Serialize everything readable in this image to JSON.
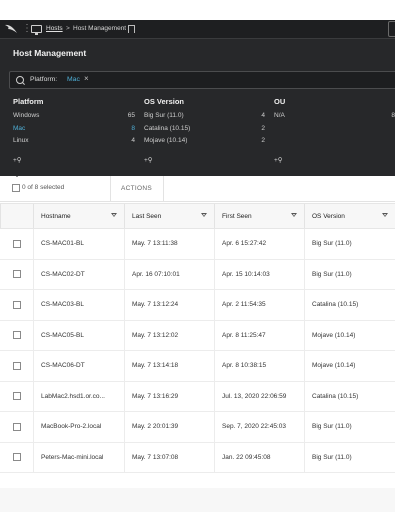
{
  "breadcrumb": {
    "hosts": "Hosts",
    "separator": ">",
    "current": "Host Management"
  },
  "page_title": "Host Management",
  "filter": {
    "key": "Platform:",
    "value": "Mac",
    "remove": "×"
  },
  "facets": {
    "platform": {
      "title": "Platform",
      "items": [
        {
          "label": "Windows",
          "count": "65"
        },
        {
          "label": "Mac",
          "count": "8"
        },
        {
          "label": "Linux",
          "count": "4"
        }
      ],
      "add": "+⚲"
    },
    "os_version": {
      "title": "OS Version",
      "items": [
        {
          "label": "Big Sur (11.0)",
          "count": "4"
        },
        {
          "label": "Catalina (10.15)",
          "count": "2"
        },
        {
          "label": "Mojave (10.14)",
          "count": "2"
        }
      ],
      "add": "+⚲"
    },
    "ou": {
      "title": "OU",
      "items": [
        {
          "label": "N/A",
          "count": "8"
        }
      ],
      "add": "+⚲"
    }
  },
  "toolbar": {
    "selection": "0 of 8 selected",
    "actions": "ACTIONS"
  },
  "table": {
    "headers": [
      "Hostname",
      "Last Seen",
      "First Seen",
      "OS Version"
    ],
    "rows": [
      [
        "CS-MAC01-BL",
        "May. 7 13:11:38",
        "Apr. 6 15:27:42",
        "Big Sur (11.0)"
      ],
      [
        "CS-MAC02-DT",
        "Apr. 16 07:10:01",
        "Apr. 15 10:14:03",
        "Big Sur (11.0)"
      ],
      [
        "CS-MAC03-BL",
        "May. 7 13:12:24",
        "Apr. 2 11:54:35",
        "Catalina (10.15)"
      ],
      [
        "CS-MAC05-BL",
        "May. 7 13:12:02",
        "Apr. 8 11:25:47",
        "Mojave (10.14)"
      ],
      [
        "CS-MAC06-DT",
        "May. 7 13:14:18",
        "Apr. 8 10:38:15",
        "Mojave (10.14)"
      ],
      [
        "LabMac2.hsd1.or.co...",
        "May. 7 13:16:29",
        "Jul. 13, 2020 22:06:59",
        "Catalina (10.15)"
      ],
      [
        "MacBook-Pro-2.local",
        "May. 2 20:01:39",
        "Sep. 7, 2020 22:45:03",
        "Big Sur (11.0)"
      ],
      [
        "Peters-Mac-mini.local",
        "May. 7 13:07:08",
        "Jan. 22 09:45:08",
        "Big Sur (11.0)"
      ]
    ]
  },
  "colors": {
    "accent": "#4fb0d8",
    "dark_panel": "#27282a"
  }
}
